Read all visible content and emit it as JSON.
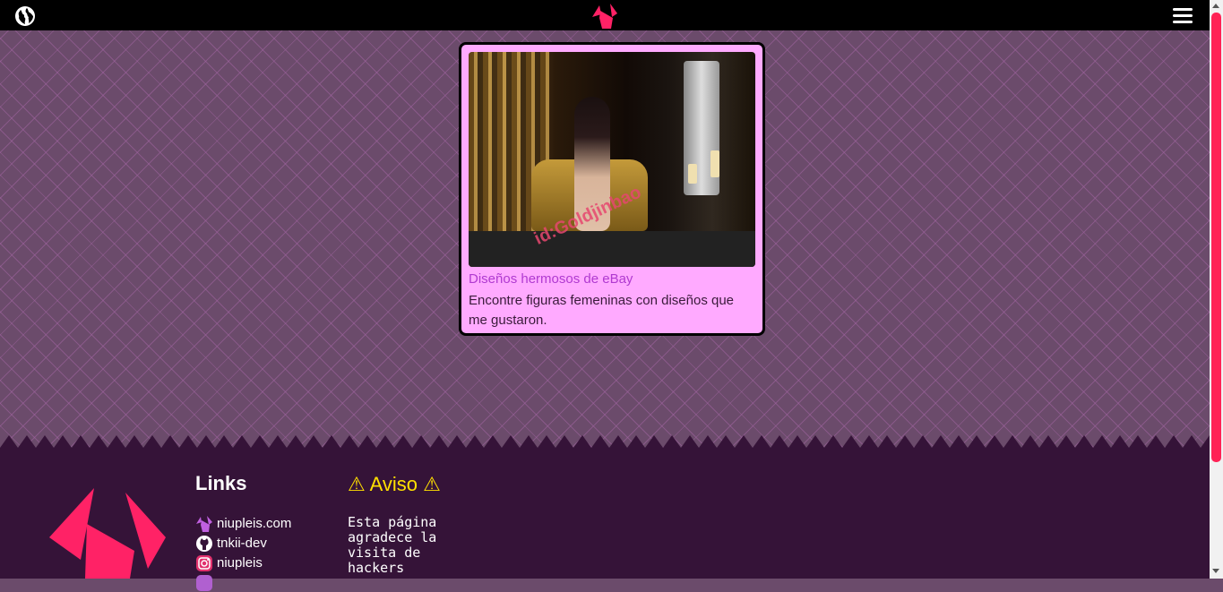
{
  "header": {
    "globe_icon": "globe-icon",
    "logo_icon": "niupleis-logo",
    "menu_icon": "hamburger-menu-icon"
  },
  "card": {
    "title": "Diseños hermosos de eBay",
    "description": "Encontre figuras femeninas con diseños que me gustaron.",
    "image_watermark": "id:Goldjinbao"
  },
  "footer": {
    "links_title": "Links",
    "links": [
      {
        "label": "niupleis.com",
        "icon": "niupleis-icon"
      },
      {
        "label": "tnkii-dev",
        "icon": "github-icon"
      },
      {
        "label": "niupleis",
        "icon": "instagram-icon"
      }
    ],
    "aviso_title": "⚠ Aviso ⚠",
    "aviso_text": "Esta página agradece la visita de hackers"
  },
  "colors": {
    "accent": "#ff2266",
    "card_bg": "#ffaaff",
    "card_title": "#b03ad0",
    "footer_bg": "#351338",
    "warning": "#ffe000"
  }
}
